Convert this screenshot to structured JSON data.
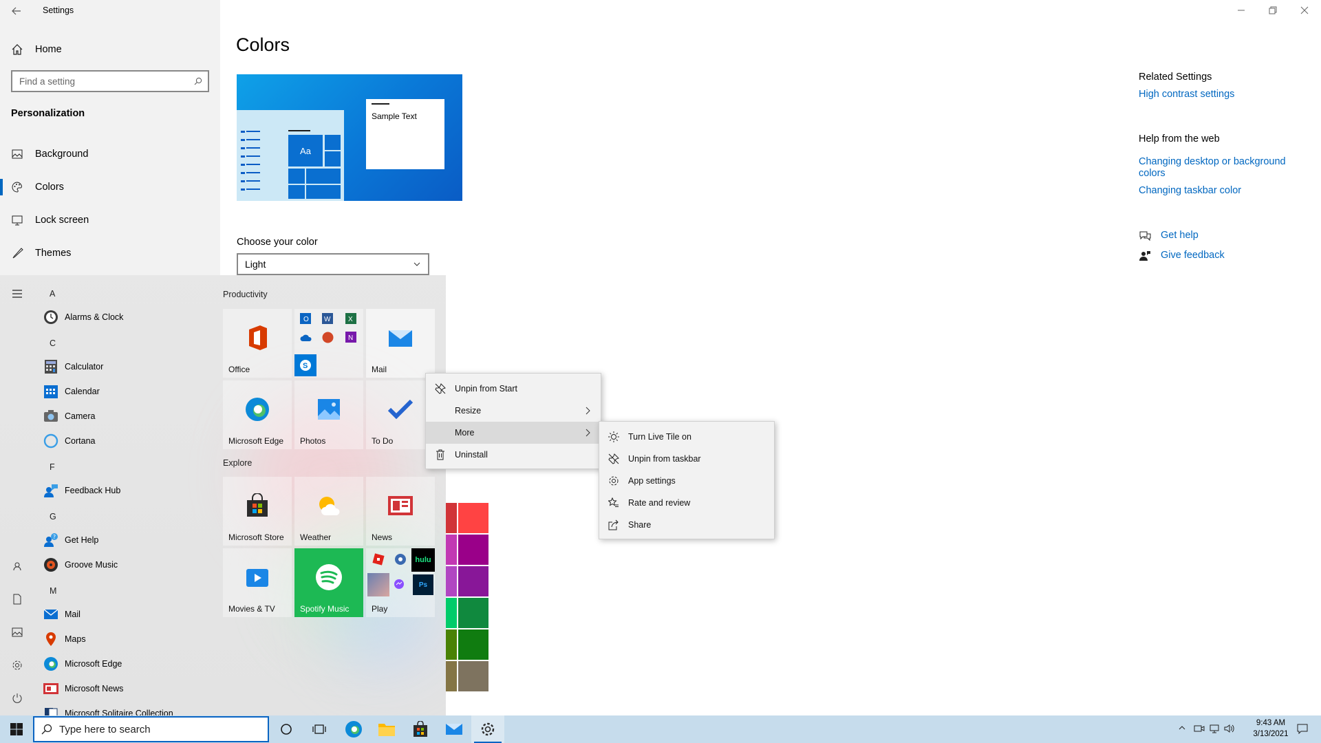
{
  "window": {
    "title": "Settings",
    "back_label": "Back",
    "minimize": "Minimize",
    "restore": "Restore",
    "close": "Close"
  },
  "sidebar": {
    "home": "Home",
    "search_placeholder": "Find a setting",
    "section": "Personalization",
    "items": [
      {
        "label": "Background",
        "icon": "picture-icon"
      },
      {
        "label": "Colors",
        "icon": "palette-icon"
      },
      {
        "label": "Lock screen",
        "icon": "monitor-icon"
      },
      {
        "label": "Themes",
        "icon": "brush-icon"
      }
    ]
  },
  "main": {
    "page_title": "Colors",
    "preview_text": "Sample Text",
    "preview_tile_label": "Aa",
    "choose_color_label": "Choose your color",
    "choose_color_value": "Light"
  },
  "related": {
    "related_title": "Related Settings",
    "high_contrast": "High contrast settings",
    "help_title": "Help from the web",
    "help_link1": "Changing desktop or background colors",
    "help_link2": "Changing taskbar color",
    "get_help": "Get help",
    "give_feedback": "Give feedback"
  },
  "start": {
    "letters": {
      "a": "A",
      "c": "C",
      "f": "F",
      "g": "G",
      "m": "M"
    },
    "apps": [
      {
        "label": "Alarms & Clock",
        "icon": "clock-icon"
      },
      {
        "label": "Calculator",
        "icon": "calculator-icon"
      },
      {
        "label": "Calendar",
        "icon": "calendar-icon"
      },
      {
        "label": "Camera",
        "icon": "camera-icon"
      },
      {
        "label": "Cortana",
        "icon": "cortana-icon"
      },
      {
        "label": "Feedback Hub",
        "icon": "feedback-icon"
      },
      {
        "label": "Get Help",
        "icon": "help-icon"
      },
      {
        "label": "Groove Music",
        "icon": "music-icon"
      },
      {
        "label": "Mail",
        "icon": "mail-icon"
      },
      {
        "label": "Maps",
        "icon": "maps-icon"
      },
      {
        "label": "Microsoft Edge",
        "icon": "edge-icon"
      },
      {
        "label": "Microsoft News",
        "icon": "news-icon"
      },
      {
        "label": "Microsoft Solitaire Collection",
        "icon": "solitaire-icon"
      }
    ],
    "groups": {
      "productivity": "Productivity",
      "explore": "Explore"
    },
    "tiles": {
      "office": "Office",
      "mail": "Mail",
      "edge": "Microsoft Edge",
      "photos": "Photos",
      "todo": "To Do",
      "store": "Microsoft Store",
      "weather": "Weather",
      "news": "News",
      "movies": "Movies & TV",
      "spotify": "Spotify Music",
      "play": "Play",
      "hulu": "hulu",
      "ps": "Ps"
    }
  },
  "context_menu": {
    "items": [
      {
        "label": "Unpin from Start",
        "icon": "unpin-icon"
      },
      {
        "label": "Resize",
        "icon": ""
      },
      {
        "label": "More",
        "icon": ""
      },
      {
        "label": "Uninstall",
        "icon": "trash-icon"
      }
    ]
  },
  "submenu": {
    "items": [
      {
        "label": "Turn Live Tile on",
        "icon": "sun-icon"
      },
      {
        "label": "Unpin from taskbar",
        "icon": "unpin-icon"
      },
      {
        "label": "App settings",
        "icon": "gear-icon"
      },
      {
        "label": "Rate and review",
        "icon": "star-icon"
      },
      {
        "label": "Share",
        "icon": "share-icon"
      }
    ]
  },
  "taskbar": {
    "search_placeholder": "Type here to search",
    "time": "9:43 AM",
    "date": "3/13/2021"
  },
  "colors": {
    "accent": "#0067c0",
    "taskbar": "#c6dcec",
    "spotify": "#1db954"
  }
}
